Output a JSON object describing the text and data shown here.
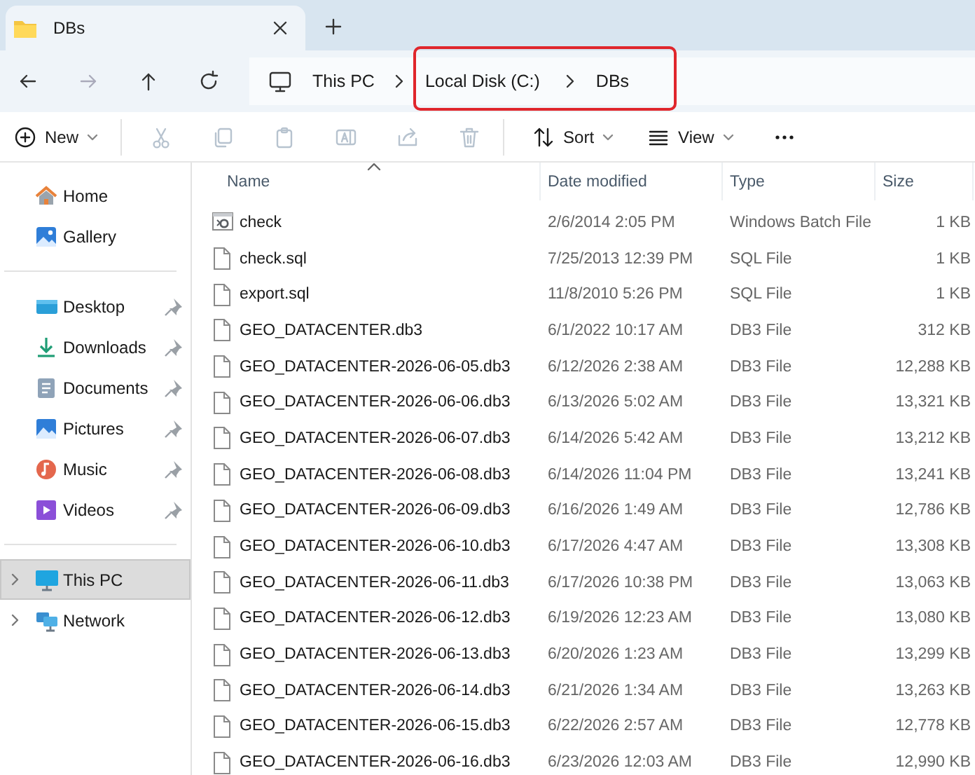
{
  "tab": {
    "title": "DBs",
    "selected": true
  },
  "nav": [
    {
      "kind": "back",
      "disabled": false
    },
    {
      "kind": "forward",
      "disabled": true
    },
    {
      "kind": "up",
      "disabled": false
    },
    {
      "kind": "refresh",
      "disabled": false
    }
  ],
  "breadcrumb": [
    "This PC",
    "Local Disk (C:)",
    "DBs"
  ],
  "toolbar": [
    {
      "kind": "new",
      "label": "New",
      "disabled": false
    },
    {
      "kind": "cut",
      "disabled": true
    },
    {
      "kind": "copy",
      "disabled": true
    },
    {
      "kind": "paste",
      "disabled": true
    },
    {
      "kind": "rename",
      "disabled": true
    },
    {
      "kind": "share",
      "disabled": true
    },
    {
      "kind": "delete",
      "disabled": true
    },
    {
      "kind": "sort",
      "label": "Sort",
      "disabled": false
    },
    {
      "kind": "view",
      "label": "View",
      "disabled": false
    },
    {
      "kind": "more",
      "disabled": false
    }
  ],
  "sidebar": {
    "groups": [
      [
        {
          "kind": "home",
          "label": "Home",
          "pinned": false,
          "selected": false,
          "expandable": false
        },
        {
          "kind": "gallery",
          "label": "Gallery",
          "pinned": false,
          "selected": false,
          "expandable": false
        }
      ],
      [
        {
          "kind": "desktop",
          "label": "Desktop",
          "pinned": true,
          "selected": false,
          "expandable": false
        },
        {
          "kind": "downloads",
          "label": "Downloads",
          "pinned": true,
          "selected": false,
          "expandable": false
        },
        {
          "kind": "documents",
          "label": "Documents",
          "pinned": true,
          "selected": false,
          "expandable": false
        },
        {
          "kind": "pictures",
          "label": "Pictures",
          "pinned": true,
          "selected": false,
          "expandable": false
        },
        {
          "kind": "music",
          "label": "Music",
          "pinned": true,
          "selected": false,
          "expandable": false
        },
        {
          "kind": "videos",
          "label": "Videos",
          "pinned": true,
          "selected": false,
          "expandable": false
        }
      ],
      [
        {
          "kind": "pc",
          "label": "This PC",
          "pinned": false,
          "selected": true,
          "expandable": true
        },
        {
          "kind": "network",
          "label": "Network",
          "pinned": false,
          "selected": false,
          "expandable": true
        }
      ]
    ]
  },
  "table": {
    "columns": [
      "Name",
      "Date modified",
      "Type",
      "Size"
    ],
    "rows": [
      {
        "kind": "batch",
        "name": "check",
        "date": "2/6/2014 2:05 PM",
        "type": "Windows Batch File",
        "size": "1 KB"
      },
      {
        "kind": "file",
        "name": "check.sql",
        "date": "7/25/2013 12:39 PM",
        "type": "SQL File",
        "size": "1 KB"
      },
      {
        "kind": "file",
        "name": "export.sql",
        "date": "11/8/2010 5:26 PM",
        "type": "SQL File",
        "size": "1 KB"
      },
      {
        "kind": "file",
        "name": "GEO_DATACENTER.db3",
        "date": "6/1/2022 10:17 AM",
        "type": "DB3 File",
        "size": "312 KB"
      },
      {
        "kind": "file",
        "name": "GEO_DATACENTER-2026-06-05.db3",
        "date": "6/12/2026 2:38 AM",
        "type": "DB3 File",
        "size": "12,288 KB"
      },
      {
        "kind": "file",
        "name": "GEO_DATACENTER-2026-06-06.db3",
        "date": "6/13/2026 5:02 AM",
        "type": "DB3 File",
        "size": "13,321 KB"
      },
      {
        "kind": "file",
        "name": "GEO_DATACENTER-2026-06-07.db3",
        "date": "6/14/2026 5:42 AM",
        "type": "DB3 File",
        "size": "13,212 KB"
      },
      {
        "kind": "file",
        "name": "GEO_DATACENTER-2026-06-08.db3",
        "date": "6/14/2026 11:04 PM",
        "type": "DB3 File",
        "size": "13,241 KB"
      },
      {
        "kind": "file",
        "name": "GEO_DATACENTER-2026-06-09.db3",
        "date": "6/16/2026 1:49 AM",
        "type": "DB3 File",
        "size": "12,786 KB"
      },
      {
        "kind": "file",
        "name": "GEO_DATACENTER-2026-06-10.db3",
        "date": "6/17/2026 4:47 AM",
        "type": "DB3 File",
        "size": "13,308 KB"
      },
      {
        "kind": "file",
        "name": "GEO_DATACENTER-2026-06-11.db3",
        "date": "6/17/2026 10:38 PM",
        "type": "DB3 File",
        "size": "13,063 KB"
      },
      {
        "kind": "file",
        "name": "GEO_DATACENTER-2026-06-12.db3",
        "date": "6/19/2026 12:23 AM",
        "type": "DB3 File",
        "size": "13,080 KB"
      },
      {
        "kind": "file",
        "name": "GEO_DATACENTER-2026-06-13.db3",
        "date": "6/20/2026 1:23 AM",
        "type": "DB3 File",
        "size": "13,299 KB"
      },
      {
        "kind": "file",
        "name": "GEO_DATACENTER-2026-06-14.db3",
        "date": "6/21/2026 1:34 AM",
        "type": "DB3 File",
        "size": "13,263 KB"
      },
      {
        "kind": "file",
        "name": "GEO_DATACENTER-2026-06-15.db3",
        "date": "6/22/2026 2:57 AM",
        "type": "DB3 File",
        "size": "12,778 KB"
      },
      {
        "kind": "file",
        "name": "GEO_DATACENTER-2026-06-16.db3",
        "date": "6/23/2026 12:03 AM",
        "type": "DB3 File",
        "size": "12,990 KB"
      }
    ]
  }
}
